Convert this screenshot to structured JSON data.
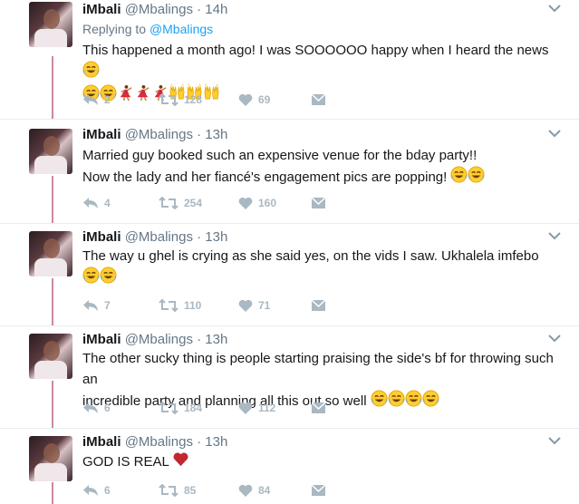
{
  "tweets": [
    {
      "name": "iMbali",
      "handle": "@Mbalings",
      "time": "14h",
      "replying_prefix": "Replying to ",
      "replying_to": "@Mbalings",
      "text": "This happened a month ago! I was SOOOOOO happy when I heard the news",
      "emojis_inline": [
        "crying-laughing"
      ],
      "emojis_line2": [
        "crying-laughing",
        "crying-laughing",
        "dancer",
        "dancer",
        "dancer",
        "raised-hands",
        "raised-hands",
        "raised-hands"
      ],
      "replies": "2",
      "retweets": "128",
      "likes": "69"
    },
    {
      "name": "iMbali",
      "handle": "@Mbalings",
      "time": "13h",
      "text_line1": "Married guy booked such an expensive venue for the bday party!!",
      "text_line2": "Now the lady and her fiancé's engagement pics are popping!",
      "emojis": [
        "crying-laughing",
        "crying-laughing"
      ],
      "replies": "4",
      "retweets": "254",
      "likes": "160"
    },
    {
      "name": "iMbali",
      "handle": "@Mbalings",
      "time": "13h",
      "text": "The way u ghel is crying as she said yes, on the vids I saw. Ukhalela imfebo",
      "emojis_line2": [
        "crying-laughing",
        "crying-laughing"
      ],
      "replies": "7",
      "retweets": "110",
      "likes": "71"
    },
    {
      "name": "iMbali",
      "handle": "@Mbalings",
      "time": "13h",
      "text_line1": "The other sucky thing is people starting praising the side's bf for throwing such an",
      "text_line2": "incredible party and planning all this out so well",
      "emojis": [
        "crying-laughing",
        "crying-laughing",
        "crying-laughing",
        "crying-laughing"
      ],
      "replies": "6",
      "retweets": "184",
      "likes": "112"
    },
    {
      "name": "iMbali",
      "handle": "@Mbalings",
      "time": "13h",
      "text": "GOD IS REAL",
      "emojis": [
        "red-heart"
      ],
      "replies": "6",
      "retweets": "85",
      "likes": "84"
    }
  ],
  "dot": "·",
  "colors": {
    "name": "#14171a",
    "muted": "#657786",
    "link": "#1da1f2",
    "action": "#aab8c2",
    "thread_line": "#c98b9a"
  }
}
